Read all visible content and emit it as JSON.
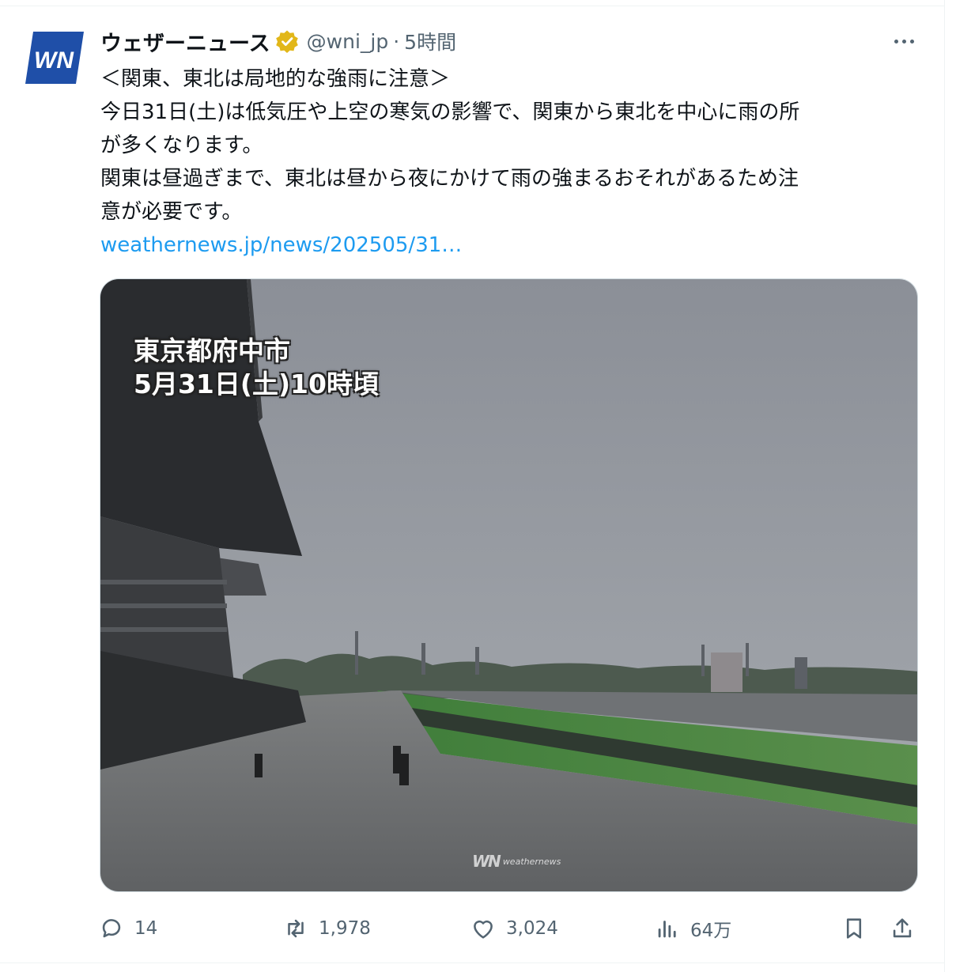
{
  "tweet": {
    "display_name": "ウェザーニュース",
    "handle": "@wni_jp",
    "separator": "·",
    "time": "5時間",
    "avatar_text": "WN",
    "text_lines": [
      "＜関東、東北は局地的な強雨に注意＞",
      "今日31日(土)は低気圧や上空の寒気の影響で、関東から東北を中心に雨の所",
      "が多くなります。",
      "関東は昼過ぎまで、東北は昼から夜にかけて雨の強まるおそれがあるため注",
      "意が必要です。"
    ],
    "link_text": "weathernews.jp/news/202505/31…",
    "media": {
      "caption_line1": "東京都府中市",
      "caption_line2": "5月31日(土)10時頃",
      "watermark_logo": "WN",
      "watermark_text": "weathernews"
    },
    "stats": {
      "replies": "14",
      "reposts": "1,978",
      "likes": "3,024",
      "views": "64万"
    },
    "colors": {
      "link": "#1d9bf0",
      "secondary": "#536471",
      "verified": "#e2b719",
      "avatar_blue": "#1f4fa8"
    },
    "icons": [
      "more-icon",
      "verified-badge-icon",
      "reply-icon",
      "repost-icon",
      "like-icon",
      "views-icon",
      "bookmark-icon",
      "share-icon"
    ]
  }
}
